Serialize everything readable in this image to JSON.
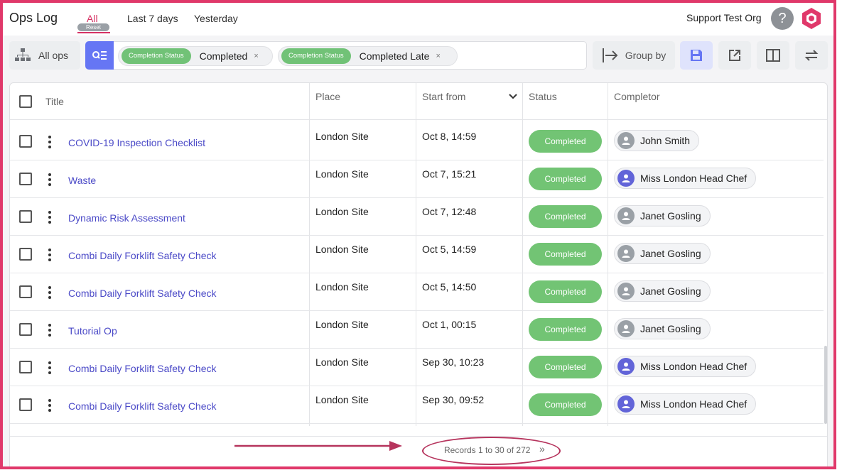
{
  "app": {
    "title": "Ops Log",
    "org_name": "Support Test Org",
    "help_label": "?"
  },
  "tabs": [
    {
      "label": "All",
      "active": true
    },
    {
      "label": "Last 7 days",
      "active": false
    },
    {
      "label": "Yesterday",
      "active": false
    }
  ],
  "reset_label": "Reset",
  "toolbar": {
    "all_ops_label": "All ops",
    "group_by_label": "Group by"
  },
  "filters": [
    {
      "field": "Completion Status",
      "value": "Completed",
      "remove": "×"
    },
    {
      "field": "Completion Status",
      "value": "Completed Late",
      "remove": "×"
    }
  ],
  "table": {
    "columns": [
      "Title",
      "Place",
      "Start from",
      "Status",
      "Completor"
    ],
    "rows": [
      {
        "title": "COVID-19 Inspection Checklist",
        "place": "London Site",
        "start": "Oct 8, 14:59",
        "status": "Completed",
        "completor": "John Smith",
        "avatar": "grey"
      },
      {
        "title": "Waste",
        "place": "London Site",
        "start": "Oct 7, 15:21",
        "status": "Completed",
        "completor": "Miss London Head Chef",
        "avatar": "purple"
      },
      {
        "title": "Dynamic Risk Assessment",
        "place": "London Site",
        "start": "Oct 7, 12:48",
        "status": "Completed",
        "completor": "Janet Gosling",
        "avatar": "grey"
      },
      {
        "title": "Combi Daily Forklift Safety Check",
        "place": "London Site",
        "start": "Oct 5, 14:59",
        "status": "Completed",
        "completor": "Janet Gosling",
        "avatar": "grey"
      },
      {
        "title": "Combi Daily Forklift Safety Check",
        "place": "London Site",
        "start": "Oct 5, 14:50",
        "status": "Completed",
        "completor": "Janet Gosling",
        "avatar": "grey"
      },
      {
        "title": "Tutorial Op",
        "place": "London Site",
        "start": "Oct 1, 00:15",
        "status": "Completed",
        "completor": "Janet Gosling",
        "avatar": "grey"
      },
      {
        "title": "Combi Daily Forklift Safety Check",
        "place": "London Site",
        "start": "Sep 30, 10:23",
        "status": "Completed",
        "completor": "Miss London Head Chef",
        "avatar": "purple"
      },
      {
        "title": "Combi Daily Forklift Safety Check",
        "place": "London Site",
        "start": "Sep 30, 09:52",
        "status": "Completed",
        "completor": "Miss London Head Chef",
        "avatar": "purple"
      }
    ]
  },
  "pagination": {
    "records_text": "Records 1 to 30 of 272",
    "next_glyph": "»"
  },
  "colors": {
    "accent": "#d63264",
    "filter_blue": "#6676f4",
    "status_green": "#72c474",
    "link": "#4a49c7",
    "frame_border": "#e0386a"
  }
}
